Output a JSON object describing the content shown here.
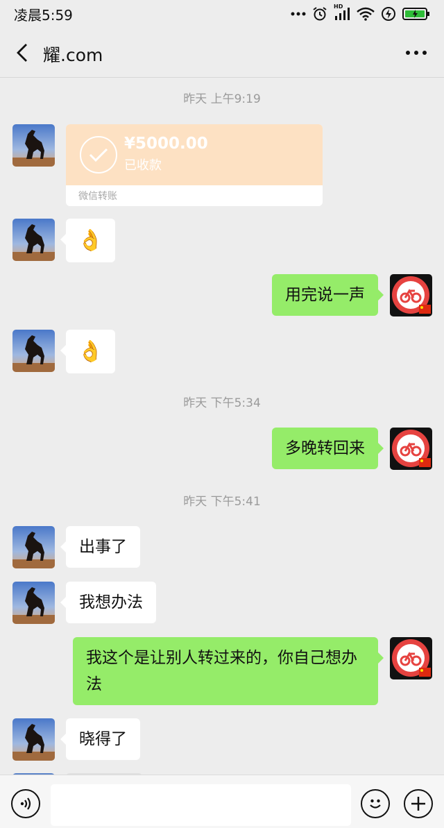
{
  "status_bar": {
    "time": "凌晨5:59",
    "network_label": "HD"
  },
  "nav": {
    "title": "耀.com"
  },
  "chat": {
    "timestamps": [
      "昨天 上午9:19",
      "昨天 下午5:34",
      "昨天 下午5:41"
    ],
    "transfer": {
      "amount": "¥5000.00",
      "status": "已收款",
      "label": "微信转账"
    },
    "messages": [
      {
        "side": "in",
        "type": "emoji",
        "emoji": "👌"
      },
      {
        "side": "out",
        "type": "text",
        "text": "用完说一声"
      },
      {
        "side": "in",
        "type": "emoji",
        "emoji": "👌"
      },
      {
        "side": "out",
        "type": "text",
        "text": "多晚转回来"
      },
      {
        "side": "in",
        "type": "text",
        "text": "出事了"
      },
      {
        "side": "in",
        "type": "text",
        "text": "我想办法"
      },
      {
        "side": "out",
        "type": "text",
        "text": "我这个是让别人转过来的，你自己想办法"
      },
      {
        "side": "in",
        "type": "text",
        "text": "晓得了"
      }
    ]
  },
  "input": {
    "placeholder": ""
  },
  "colors": {
    "background": "#ededed",
    "out_bubble": "#95ec69",
    "in_bubble": "#ffffff",
    "transfer": "#fde1c3",
    "self_avatar": "#e64340"
  },
  "icons": [
    "back-arrow-icon",
    "more-icon",
    "voice-icon",
    "emoji-face-icon",
    "plus-icon",
    "checkmark-icon",
    "bike-icon",
    "china-flag-icon"
  ]
}
